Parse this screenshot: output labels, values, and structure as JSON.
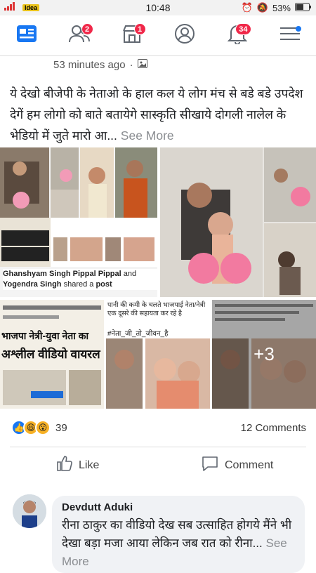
{
  "status_bar": {
    "carrier": "Idea",
    "time": "10:48",
    "battery": "53%"
  },
  "nav": {
    "friends_badge": "2",
    "marketplace_badge": "1",
    "notifications_badge": "34"
  },
  "post": {
    "time": "53 minutes ago",
    "text": "ये देखो  बीजेपी के नेताओ के हाल कल ये लोग मंच से बडे बडे उपदेश देगें  हम लोगो को बाते बतायेगे  सास्कृति सीखाये दोगली नालेल के भेडियो में जुते मारो  आ...",
    "see_more": " See More",
    "shared_name1": "Ghanshyam Singh Pippal Pippal",
    "shared_and": " and ",
    "shared_name2": "Yogendra Singh",
    "shared_tail": " shared a ",
    "shared_post": "post",
    "more_photos": "+3",
    "reaction_count": "39",
    "comment_count": "12 Comments",
    "like_label": "Like",
    "comment_label": "Comment"
  },
  "newspaper": {
    "headline1": "भाजपा नेत्री-युवा नेता का",
    "headline2": "अश्लील वीडियो वायरल",
    "caption": "पानी की कमी के चलते भाजपाई नेता/नेत्री एक दूसरे की सहायता कर रहे है",
    "tag": "#नेता_जी_तो_जीवन_है"
  },
  "comment": {
    "name": "Devdutt Aduki",
    "text": "रीना ठाकुर का वीडियो देख सब उत्साहित होगये मैंने भी देखा बड़ा मजा आया लेकिन जब रात को रीना...",
    "see_more": " See More"
  }
}
